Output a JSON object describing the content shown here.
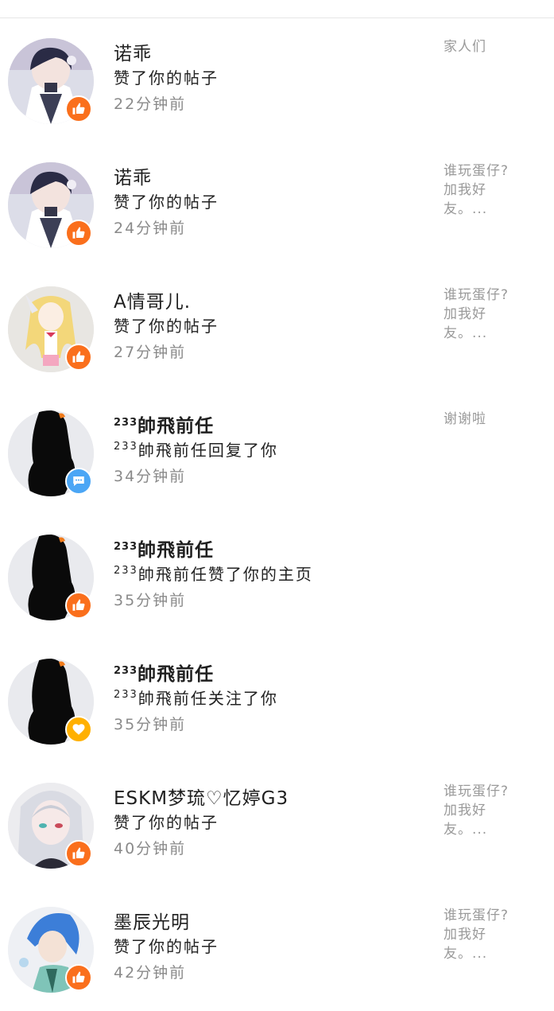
{
  "colors": {
    "like_badge": "#fa6f1c",
    "reply_badge": "#4ba6f5",
    "follow_badge": "#ffb000"
  },
  "notifications": [
    {
      "name": "诺乖",
      "action": "赞了你的帖子",
      "time": "22分钟前",
      "preview": "家人们",
      "badge": "thumbs-up-icon",
      "avatar": "anime-boy-dark-hair"
    },
    {
      "name": "诺乖",
      "action": "赞了你的帖子",
      "time": "24分钟前",
      "preview": "谁玩蛋仔?加我好友。...",
      "badge": "thumbs-up-icon",
      "avatar": "anime-boy-dark-hair"
    },
    {
      "name": "A情哥儿.",
      "action": "赞了你的帖子",
      "time": "27分钟前",
      "preview": "谁玩蛋仔?加我好友。...",
      "badge": "thumbs-up-icon",
      "avatar": "anime-girl-blonde"
    },
    {
      "name_sup": "233",
      "name": "帥飛前任",
      "action_sup": "233",
      "action": "帥飛前任回复了你",
      "time": "34分钟前",
      "preview": "谢谢啦",
      "badge": "chat-bubble-icon",
      "avatar": "silhouette"
    },
    {
      "name_sup": "233",
      "name": "帥飛前任",
      "action_sup": "233",
      "action": "帥飛前任赞了你的主页",
      "time": "35分钟前",
      "preview": "",
      "badge": "thumbs-up-icon",
      "avatar": "silhouette"
    },
    {
      "name_sup": "233",
      "name": "帥飛前任",
      "action_sup": "233",
      "action": "帥飛前任关注了你",
      "time": "35分钟前",
      "preview": "",
      "badge": "heart-icon",
      "avatar": "silhouette"
    },
    {
      "name": "ESKM梦琉♡忆婷G3",
      "action": "赞了你的帖子",
      "time": "40分钟前",
      "preview": "谁玩蛋仔?加我好友。...",
      "badge": "thumbs-up-icon",
      "avatar": "anime-girl-white-hair"
    },
    {
      "name": "墨辰光明",
      "action": "赞了你的帖子",
      "time": "42分钟前",
      "preview": "谁玩蛋仔?加我好友。...",
      "badge": "thumbs-up-icon",
      "avatar": "anime-boy-blue-hair"
    }
  ]
}
